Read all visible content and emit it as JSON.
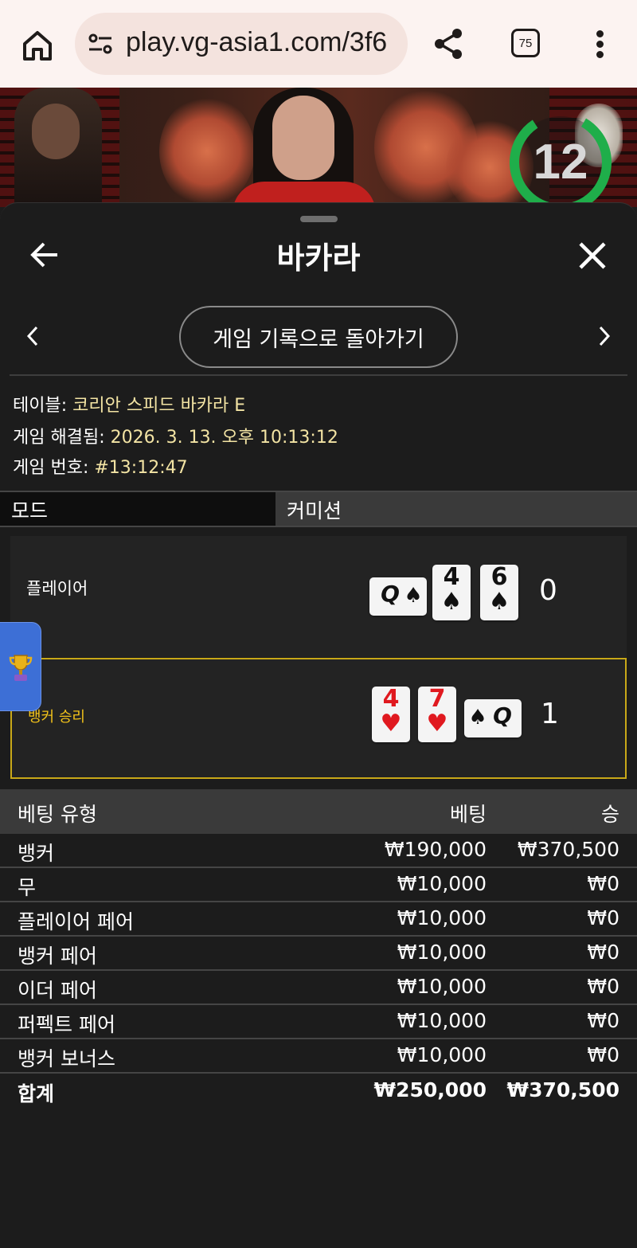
{
  "browser": {
    "url": "play.vg-asia1.com/3f6",
    "tab_count": "75"
  },
  "video": {
    "countdown": "12"
  },
  "sheet": {
    "title": "바카라",
    "back_to_history": "게임 기록으로 돌아가기"
  },
  "info": {
    "table_label": "테이블: ",
    "table_value": "코리안 스피드 바카라 E",
    "resolved_label": "게임 해결됨: ",
    "resolved_value": "2026. 3. 13. 오후 10:13:12",
    "game_no_label": "게임 번호: ",
    "game_no_value": "#13:12:47"
  },
  "mode": {
    "label": "모드",
    "value": "커미션"
  },
  "player": {
    "label": "플레이어",
    "score": "0",
    "cards": [
      {
        "rank": "Q",
        "suit": "♠",
        "color": "black",
        "orientation": "horizontal"
      },
      {
        "rank": "4",
        "suit": "♠",
        "color": "black",
        "orientation": "vertical"
      },
      {
        "rank": "6",
        "suit": "♠",
        "color": "black",
        "orientation": "vertical"
      }
    ]
  },
  "banker": {
    "label": "뱅커 승리",
    "score": "1",
    "cards": [
      {
        "rank": "4",
        "suit": "♥",
        "color": "red",
        "orientation": "vertical"
      },
      {
        "rank": "7",
        "suit": "♥",
        "color": "red",
        "orientation": "vertical"
      },
      {
        "rank": "Q",
        "suit": "♠",
        "color": "black",
        "orientation": "horizontal"
      }
    ]
  },
  "bets": {
    "headers": {
      "type": "베팅 유형",
      "bet": "베팅",
      "win": "승"
    },
    "rows": [
      {
        "type": "뱅커",
        "bet": "₩190,000",
        "win": "₩370,500"
      },
      {
        "type": "무",
        "bet": "₩10,000",
        "win": "₩0"
      },
      {
        "type": "플레이어 페어",
        "bet": "₩10,000",
        "win": "₩0"
      },
      {
        "type": "뱅커 페어",
        "bet": "₩10,000",
        "win": "₩0"
      },
      {
        "type": "이더 페어",
        "bet": "₩10,000",
        "win": "₩0"
      },
      {
        "type": "퍼펙트 페어",
        "bet": "₩10,000",
        "win": "₩0"
      },
      {
        "type": "뱅커 보너스",
        "bet": "₩10,000",
        "win": "₩0"
      }
    ],
    "total": {
      "type": "합계",
      "bet": "₩250,000",
      "win": "₩370,500"
    }
  },
  "colors": {
    "win_gold": "#f2c21a",
    "info_value": "#f3e4a4",
    "timer_green": "#1fae4a",
    "tab_blue": "#3d6fd6"
  },
  "icons": [
    "home-icon",
    "site-settings-icon",
    "share-icon",
    "tab-switcher-icon",
    "more-menu-icon",
    "back-arrow-icon",
    "close-icon",
    "chevron-left-icon",
    "chevron-right-icon",
    "trophy-icon"
  ]
}
